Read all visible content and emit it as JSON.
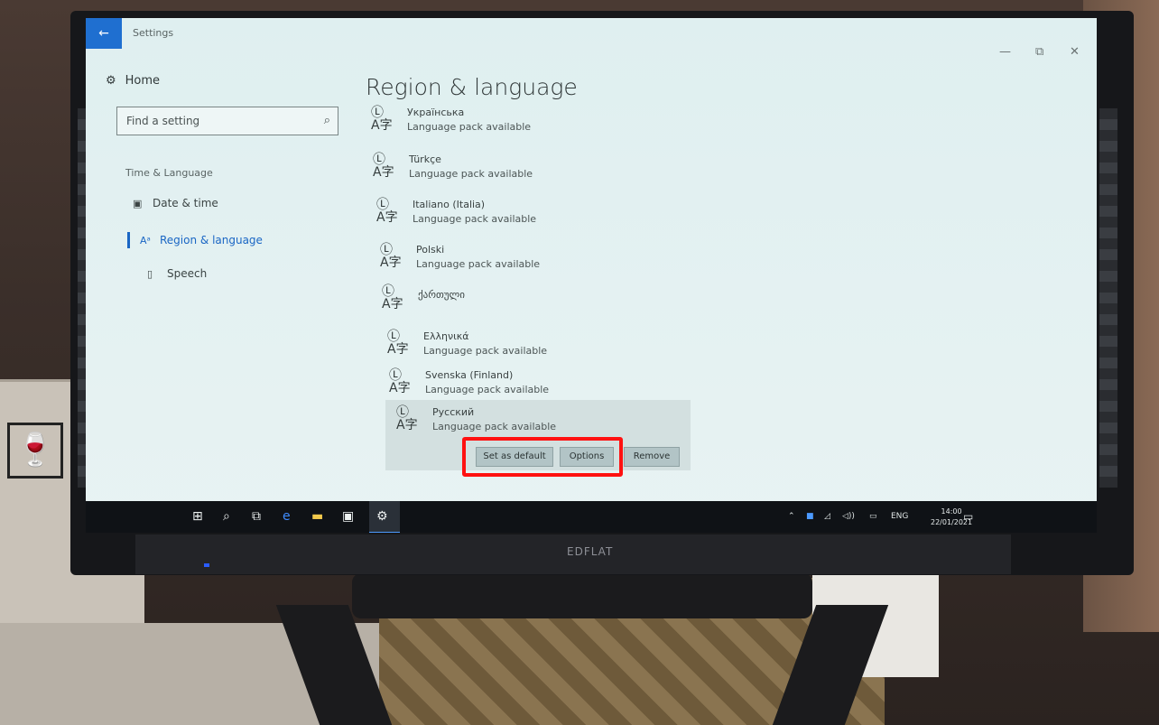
{
  "window": {
    "app_title": "Settings",
    "back_icon": "←",
    "minimize": "—",
    "maximize": "⧉",
    "close": "✕"
  },
  "sidebar": {
    "home_label": "Home",
    "search_placeholder": "Find a setting",
    "section_label": "Time & Language",
    "items": [
      {
        "label": "Date & time",
        "icon": "calendar-icon",
        "active": false
      },
      {
        "label": "Region & language",
        "icon": "language-icon",
        "active": true
      },
      {
        "label": "Speech",
        "icon": "microphone-icon",
        "active": false
      }
    ]
  },
  "main": {
    "title": "Region & language",
    "languages": [
      {
        "name": "Українська",
        "status": "Language pack available"
      },
      {
        "name": "Türkçe",
        "status": "Language pack available"
      },
      {
        "name": "Italiano (Italia)",
        "status": "Language pack available"
      },
      {
        "name": "Polski",
        "status": "Language pack available"
      },
      {
        "name": "ქართული",
        "status": ""
      },
      {
        "name": "Ελληνικά",
        "status": "Language pack available"
      },
      {
        "name": "Svenska (Finland)",
        "status": "Language pack available"
      },
      {
        "name": "Русский",
        "status": "Language pack available"
      }
    ],
    "buttons": {
      "set_default": "Set as default",
      "options": "Options",
      "remove": "Remove"
    }
  },
  "taskbar": {
    "tray_lang": "ENG",
    "time": "14:00",
    "date": "22/01/2021"
  },
  "monitor": {
    "brand": "EDFLAT"
  },
  "colors": {
    "accent": "#1a66c4",
    "highlight": "#ff1111"
  }
}
